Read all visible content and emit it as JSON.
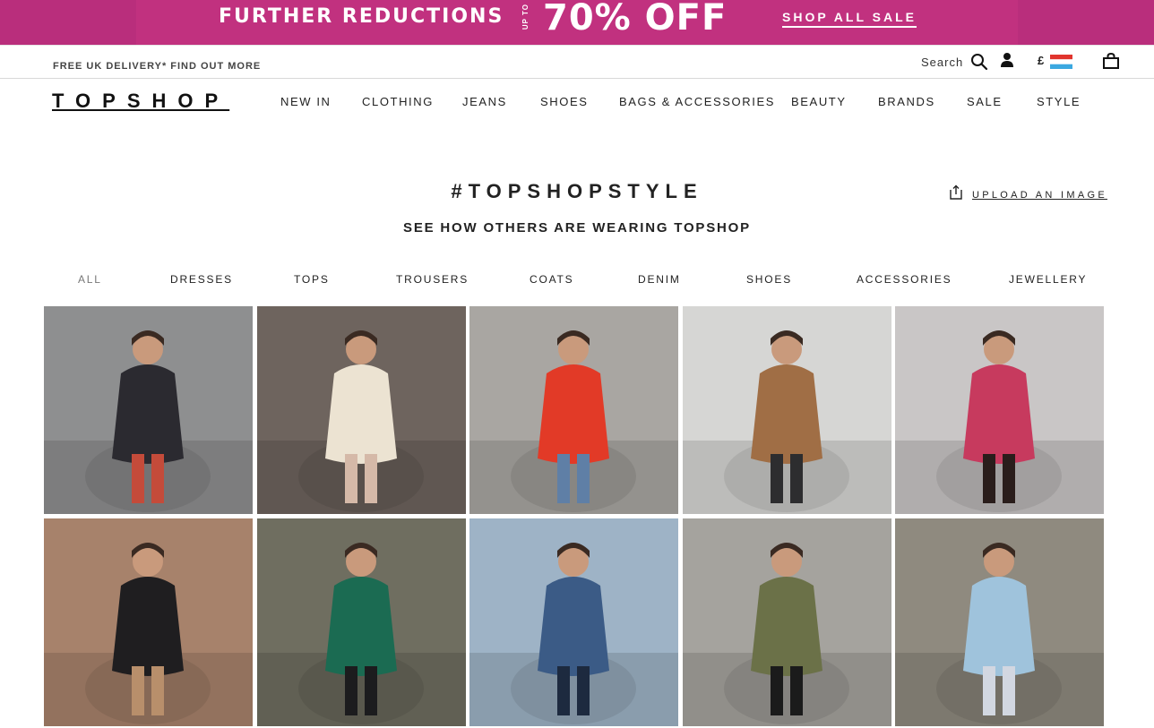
{
  "promo": {
    "text": "FURTHER REDUCTIONS",
    "upto": "UP TO",
    "discount": "70% OFF",
    "link": "SHOP ALL SALE",
    "colors": {
      "banner": "#c1317f",
      "banner_edge": "#b92e7c"
    }
  },
  "utility": {
    "delivery": "FREE UK DELIVERY* FIND OUT MORE",
    "search_label": "Search",
    "currency": "£",
    "icons": [
      "search-icon",
      "account-icon",
      "flag-icon",
      "bag-icon"
    ]
  },
  "header": {
    "logo": "TOPSHOP",
    "nav": [
      "NEW IN",
      "CLOTHING",
      "JEANS",
      "SHOES",
      "BAGS & ACCESSORIES",
      "BEAUTY",
      "BRANDS",
      "SALE",
      "STYLE"
    ]
  },
  "main": {
    "title": "#TOPSHOPSTYLE",
    "subtitle": "SEE HOW OTHERS ARE WEARING TOPSHOP",
    "upload_label": "UPLOAD AN IMAGE",
    "filters": [
      "ALL",
      "DRESSES",
      "TOPS",
      "TROUSERS",
      "COATS",
      "DENIM",
      "SHOES",
      "ACCESSORIES",
      "JEWELLERY"
    ],
    "active_filter": "ALL"
  },
  "gallery": {
    "tiles": [
      {
        "bg": "#8e8f90",
        "accent": "#2b2a30",
        "detail": "#c44b3a"
      },
      {
        "bg": "#6e645e",
        "accent": "#ece3d2",
        "detail": "#d5b9a8"
      },
      {
        "bg": "#a9a6a2",
        "accent": "#e23a27",
        "detail": "#5f7fa6"
      },
      {
        "bg": "#d6d6d4",
        "accent": "#a06e45",
        "detail": "#2d2d2f"
      },
      {
        "bg": "#c9c6c6",
        "accent": "#c73a5e",
        "detail": "#2a1d1b"
      },
      {
        "bg": "#a7826b",
        "accent": "#1f1e20",
        "detail": "#b88f6b"
      },
      {
        "bg": "#6f6e60",
        "accent": "#1b6b52",
        "detail": "#1c1c1e"
      },
      {
        "bg": "#9eb3c6",
        "accent": "#3b5b86",
        "detail": "#1d2a3f"
      },
      {
        "bg": "#a5a39e",
        "accent": "#6b7148",
        "detail": "#1b1b1b"
      },
      {
        "bg": "#8f8a7f",
        "accent": "#9fc3dc",
        "detail": "#d2d7e1"
      }
    ]
  }
}
